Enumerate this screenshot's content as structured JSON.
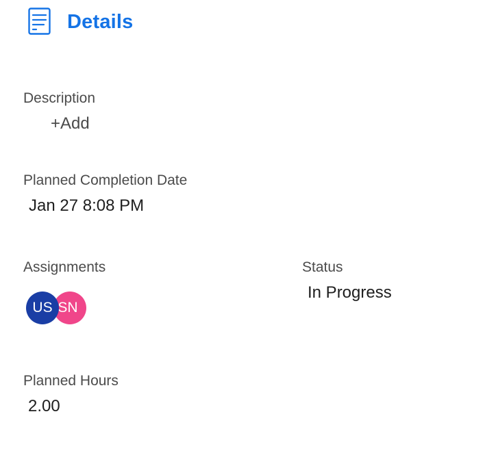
{
  "header": {
    "title": "Details",
    "icon": "document-icon",
    "accent_color": "#1473e6"
  },
  "description": {
    "label": "Description",
    "add_label": "+Add"
  },
  "planned_completion": {
    "label": "Planned Completion Date",
    "value": "Jan 27 8:08 PM"
  },
  "assignments": {
    "label": "Assignments",
    "avatars": [
      {
        "initials": "US",
        "color": "#1a3ea5"
      },
      {
        "initials": "SN",
        "color": "#f0468a"
      }
    ]
  },
  "status": {
    "label": "Status",
    "value": "In Progress"
  },
  "planned_hours": {
    "label": "Planned Hours",
    "value": "2.00"
  }
}
